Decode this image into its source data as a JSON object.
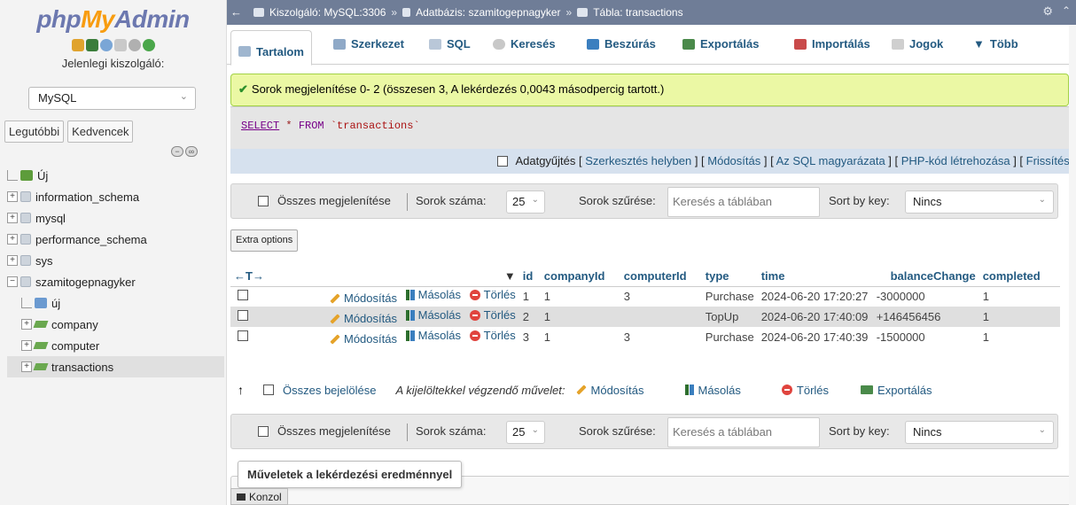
{
  "nav": {
    "logo": {
      "php": "php",
      "my": "My",
      "admin": "Admin"
    },
    "icons": [
      "home-icon",
      "exit-icon",
      "help-icon",
      "docs-icon",
      "settings-icon",
      "reload-icon"
    ],
    "server_label": "Jelenlegi kiszolgáló:",
    "server_select": "MySQL",
    "tab_recent": "Legutóbbi",
    "tab_favorites": "Kedvencek",
    "tree": {
      "new": "Új",
      "dbs": [
        "information_schema",
        "mysql",
        "performance_schema",
        "sys",
        "szamitogepnagyker"
      ],
      "sub_new": "új",
      "tables": [
        "company",
        "computer",
        "transactions"
      ]
    }
  },
  "topbar": {
    "server": "Kiszolgáló: MySQL:3306",
    "database": "Adatbázis: szamitogepnagyker",
    "table": "Tábla: transactions",
    "sep": "»"
  },
  "tabs": {
    "tartalom": "Tartalom",
    "szerkezet": "Szerkezet",
    "sql": "SQL",
    "kereses": "Keresés",
    "beszuras": "Beszúrás",
    "exportalas": "Exportálás",
    "importalas": "Importálás",
    "jogok": "Jogok",
    "tobb": "Több"
  },
  "message": "Sorok megjelenítése 0- 2 (összesen 3, A lekérdezés 0,0043 másodpercig tartott.)",
  "sql": {
    "select": "SELECT",
    "star": "*",
    "from": "FROM",
    "table": "`transactions`"
  },
  "sqllinks": {
    "profiling": "Adatgyűjtés",
    "edit_inline": "Szerkesztés helyben",
    "edit": "Módosítás",
    "explain": "Az SQL magyarázata",
    "php": "PHP-kód létrehozása",
    "refresh": "Frissítés",
    "open": "[ ",
    "mid": " ] [ ",
    "close": " ]"
  },
  "navbox": {
    "show_all": "Összes megjelenítése",
    "rows_label": "Sorok száma:",
    "rows_value": "25",
    "filter_label": "Sorok szűrése:",
    "filter_placeholder": "Keresés a táblában",
    "sort_label": "Sort by key:",
    "sort_value": "Nincs"
  },
  "extra_options": "Extra options",
  "table": {
    "arrows": "←T→",
    "sort_arrow": "▼",
    "columns": [
      "id",
      "companyId",
      "computerId",
      "type",
      "time",
      "balanceChange",
      "completed"
    ],
    "actions": {
      "edit": "Módosítás",
      "copy": "Másolás",
      "delete": "Törlés"
    },
    "rows": [
      {
        "id": "1",
        "companyId": "1",
        "computerId": "3",
        "type": "Purchase",
        "time": "2024-06-20 17:20:27",
        "balanceChange": "-3000000",
        "completed": "1"
      },
      {
        "id": "2",
        "companyId": "1",
        "computerId": "",
        "type": "TopUp",
        "time": "2024-06-20 17:40:09",
        "balanceChange": "+146456456",
        "completed": "1"
      },
      {
        "id": "3",
        "companyId": "1",
        "computerId": "3",
        "type": "Purchase",
        "time": "2024-06-20 17:40:39",
        "balanceChange": "-1500000",
        "completed": "1"
      }
    ]
  },
  "bulk": {
    "check_all": "Összes bejelölése",
    "with_selected": "A kijelöltekkel végzendő művelet:",
    "edit": "Módosítás",
    "copy": "Másolás",
    "delete": "Törlés",
    "export": "Exportálás"
  },
  "ops_legend": "Műveletek a lekérdezési eredménnyel",
  "console": "Konzol",
  "colors": {
    "topbar": "#6f7d97",
    "link": "#235a81",
    "success_bg": "#ebf8a4",
    "stripe": "#dfdfdf"
  }
}
